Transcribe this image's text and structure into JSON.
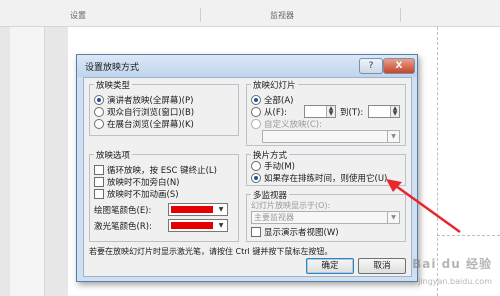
{
  "ribbon": {
    "group_1": "设置",
    "group_2": "监视器"
  },
  "dialog": {
    "title": "设置放映方式",
    "help_label": "?",
    "close_label": "X",
    "show_type": {
      "legend": "放映类型",
      "options": [
        {
          "label": "演讲者放映(全屏幕)(P)",
          "selected": true
        },
        {
          "label": "观众自行浏览(窗口)(B)",
          "selected": false
        },
        {
          "label": "在展台浏览(全屏幕)(K)",
          "selected": false
        }
      ]
    },
    "slides": {
      "legend": "放映幻灯片",
      "all_label": "全部(A)",
      "from_label": "从(F):",
      "from_value": "",
      "to_label": "到(T):",
      "to_value": "",
      "custom_label": "自定义放映(C):",
      "custom_value": ""
    },
    "show_options": {
      "legend": "放映选项",
      "loop_label": "循环放映，按 ESC 键终止(L)",
      "no_narration_label": "放映时不加旁白(N)",
      "no_animation_label": "放映时不加动画(S)",
      "pen_color_label": "绘图笔颜色(E):",
      "pen_color": "#e60000",
      "laser_color_label": "激光笔颜色(R):",
      "laser_color": "#e60000"
    },
    "advance": {
      "legend": "换片方式",
      "options": [
        {
          "label": "手动(M)",
          "selected": false
        },
        {
          "label": "如果存在排练时间，则使用它(U)",
          "selected": true
        }
      ]
    },
    "monitors": {
      "legend": "多监视器",
      "display_on_label": "幻灯片放映显示于(O):",
      "display_on_value": "主要监视器",
      "presenter_view_label": "显示演示者视图(W)"
    },
    "hint": "若要在放映幻灯片时显示激光笔，请按住 Ctrl 键并按下鼠标左按钮。",
    "ok_label": "确定",
    "cancel_label": "取消"
  },
  "watermark": {
    "text": "Bai du 经验",
    "url": "jingyan.baidu.com"
  },
  "colors": {
    "arrow": "#e8262c",
    "title_bg": "#cfe0f2"
  }
}
